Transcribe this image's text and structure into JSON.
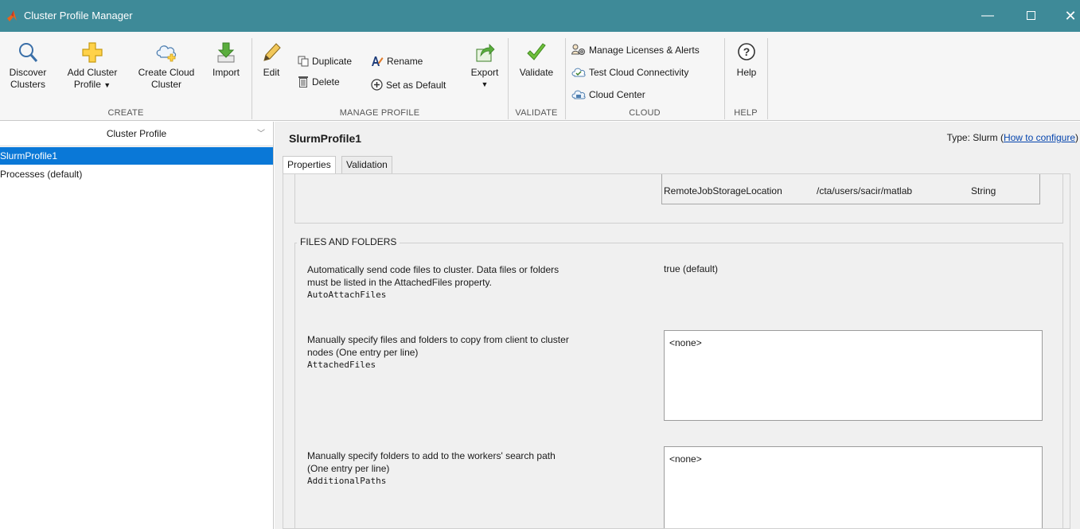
{
  "window": {
    "title": "Cluster Profile Manager",
    "min_glyph": "—",
    "close_glyph": "✕"
  },
  "toolstrip": {
    "create": {
      "label": "CREATE",
      "discover_line1": "Discover",
      "discover_line2": "Clusters",
      "add_line1": "Add Cluster",
      "add_line2": "Profile",
      "cloud_line1": "Create Cloud",
      "cloud_line2": "Cluster",
      "import": "Import"
    },
    "manage": {
      "label": "MANAGE PROFILE",
      "edit": "Edit",
      "duplicate": "Duplicate",
      "rename": "Rename",
      "delete": "Delete",
      "set_default": "Set as Default",
      "export": "Export"
    },
    "validate": {
      "label": "VALIDATE",
      "validate": "Validate"
    },
    "cloud": {
      "label": "CLOUD",
      "manage_licenses": "Manage Licenses & Alerts",
      "test_connectivity": "Test Cloud Connectivity",
      "cloud_center": "Cloud Center"
    },
    "help": {
      "label": "HELP",
      "help": "Help"
    }
  },
  "profiles": {
    "header": "Cluster Profile",
    "items": [
      {
        "label": "SlurmProfile1",
        "selected": true
      },
      {
        "label": "Processes (default)",
        "selected": false
      }
    ]
  },
  "detail": {
    "title": "SlurmProfile1",
    "type_text": "Type: Slurm (",
    "type_link": "How to configure",
    "type_close": ")",
    "tabs": [
      "Properties",
      "Validation"
    ],
    "remote_storage": {
      "name": "RemoteJobStorageLocation",
      "value": "/cta/users/sacir/matlab",
      "type": "String"
    },
    "files_section": {
      "title": "FILES AND FOLDERS",
      "auto_attach": {
        "desc_line1": "Automatically send code files to cluster. Data files or folders",
        "desc_line2": "must be listed in the AttachedFiles property.",
        "prop": "AutoAttachFiles",
        "value": "true (default)"
      },
      "attached_files": {
        "desc_line1": "Manually specify files and folders to copy from client to cluster",
        "desc_line2": "nodes (One entry per line)",
        "prop": "AttachedFiles",
        "value": "<none>"
      },
      "additional_paths": {
        "desc_line1": "Manually specify folders to add to the workers' search path",
        "desc_line2": "(One entry per line)",
        "prop": "AdditionalPaths",
        "value": "<none>"
      }
    }
  }
}
